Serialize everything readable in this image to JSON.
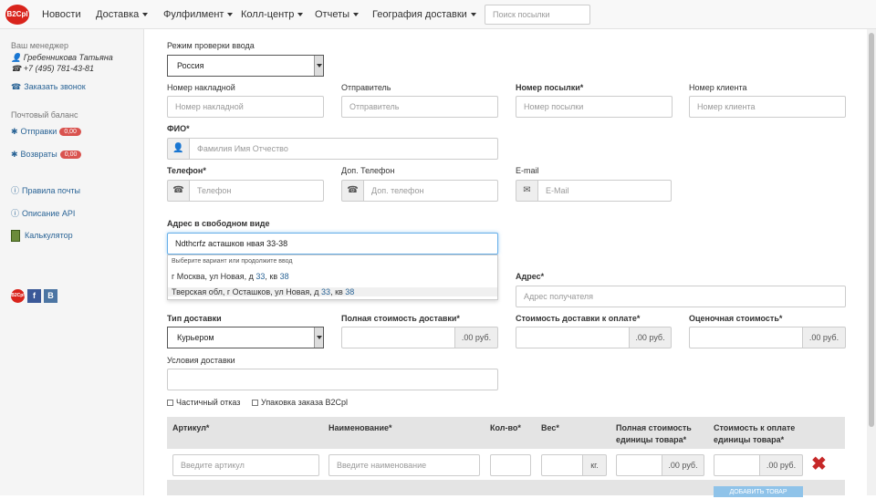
{
  "header": {
    "logo": "B2Cpl",
    "nav": [
      {
        "label": "Новости",
        "caret": false
      },
      {
        "label": "Доставка",
        "caret": true
      },
      {
        "label": "Фулфилмент",
        "caret": true
      },
      {
        "label": "Колл-центр",
        "caret": true
      },
      {
        "label": "Отчеты",
        "caret": true
      },
      {
        "label": "География доставки",
        "caret": true
      }
    ],
    "search_placeholder": "Поиск посылки"
  },
  "sidebar": {
    "manager_title": "Ваш менеджер",
    "manager_name": "Гребенникова Татьяна",
    "manager_phone": "+7 (495) 781-43-81",
    "call_link": "Заказать звонок",
    "balance_title": "Почтовый баланс",
    "sends_label": "Отправки",
    "sends_value": "0,00",
    "returns_label": "Возвраты",
    "returns_value": "0,00",
    "rules_link": "Правила почты",
    "api_link": "Описание API",
    "calc_link": "Калькулятор",
    "social": [
      "B2Cpl",
      "f",
      "B"
    ]
  },
  "form": {
    "mode_label": "Режим проверки ввода",
    "mode_value": "Россия",
    "invoice_label": "Номер накладной",
    "invoice_placeholder": "Номер накладной",
    "sender_label": "Отправитель",
    "sender_placeholder": "Отправитель",
    "parcel_label": "Номер посылки*",
    "parcel_placeholder": "Номер посылки",
    "client_label": "Номер клиента",
    "client_placeholder": "Номер клиента",
    "fio_label": "ФИО*",
    "fio_placeholder": "Фамилия Имя Отчество",
    "phone_label": "Телефон*",
    "phone_placeholder": "Телефон",
    "phone2_label": "Доп. Телефон",
    "phone2_placeholder": "Доп. телефон",
    "email_label": "E-mail",
    "email_placeholder": "E-Mail",
    "free_address_label": "Адрес в свободном виде",
    "free_address_value": "Ndthcrfz асташков нвая 33-38",
    "autocomplete": {
      "hint": "Выберите вариант или продолжите ввод",
      "option1_pre": "г Москва, ул Новая, д ",
      "option1_h1": "33",
      "option1_mid": ", кв ",
      "option1_h2": "38",
      "option2_pre": "Тверская обл, г Осташков, ул Новая, д ",
      "option2_h1": "33",
      "option2_mid": ", кв ",
      "option2_h2": "38"
    },
    "address_label": "Адрес*",
    "address_placeholder": "Адрес получателя",
    "delivery_type_label": "Тип доставки",
    "delivery_type_value": "Курьером",
    "full_cost_label": "Полная стоимость доставки*",
    "pay_cost_label": "Стоимость доставки к оплате*",
    "est_cost_label": "Оценочная стоимость*",
    "currency": ".00 руб.",
    "conditions_label": "Условия доставки",
    "partial_refuse": "Частичный отказ",
    "b2c_pack": "Упаковка заказа B2Cpl"
  },
  "table": {
    "headers": [
      "Артикул*",
      "Наименование*",
      "Кол-во*",
      "Вес*",
      "Полная стоимость единицы товара*",
      "Стоимость к оплате единицы товара*"
    ],
    "article_placeholder": "Введите артикул",
    "name_placeholder": "Введите наименование",
    "weight_unit": "кг.",
    "currency": ".00 руб.",
    "add_button": "ДОБАВИТЬ ТОВАР"
  }
}
